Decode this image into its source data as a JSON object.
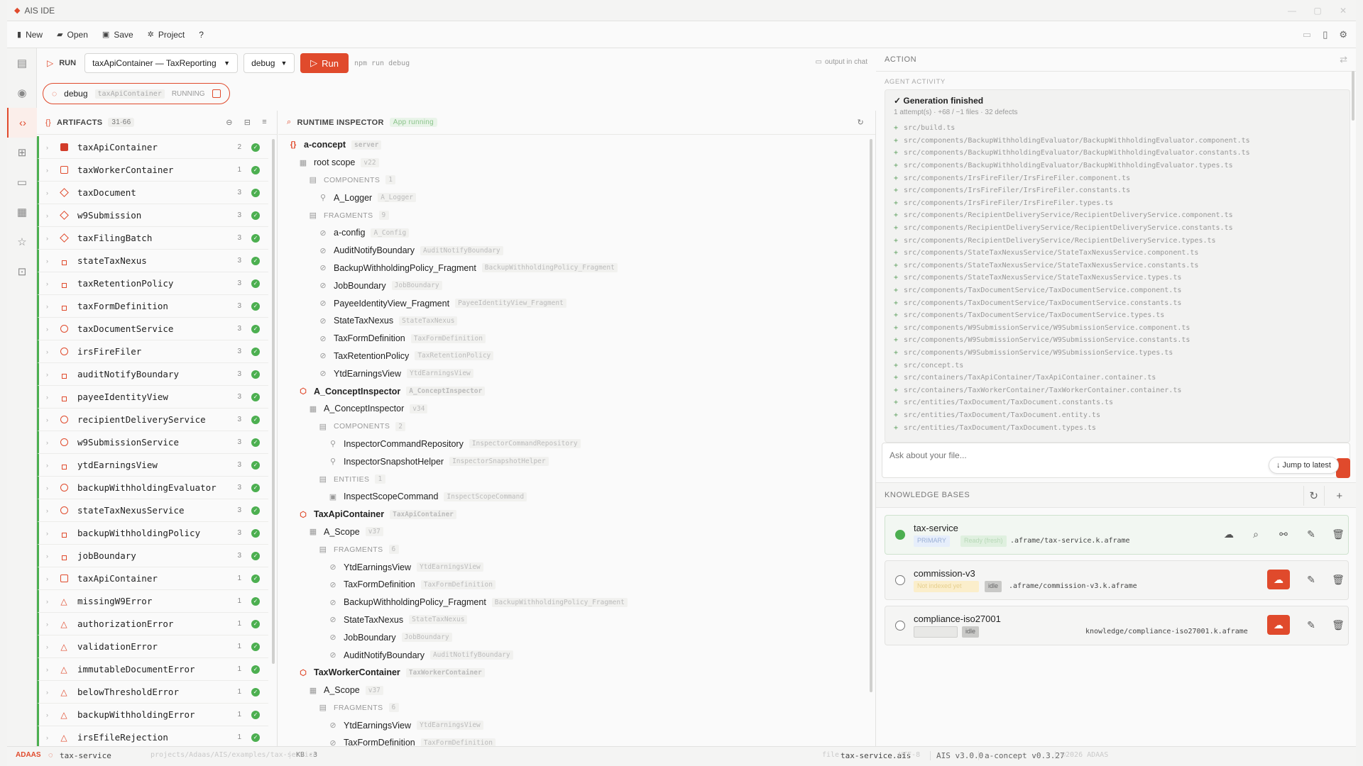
{
  "app": {
    "title": "AIS IDE"
  },
  "menu": {
    "new": "New",
    "open": "Open",
    "save": "Save",
    "project": "Project",
    "help": "?"
  },
  "run": {
    "label": "RUN",
    "target": "taxApiContainer — TaxReporting",
    "mode": "debug",
    "run_button": "Run",
    "command_hint": "npm run debug",
    "output_link": "output in chat"
  },
  "debug_session": {
    "name": "debug",
    "container": "taxApiContainer",
    "status": "RUNNING"
  },
  "artifacts": {
    "title": "ARTIFACTS",
    "count": "31·66",
    "items": [
      {
        "name": "taxApiContainer",
        "count": "2",
        "icon": "sq"
      },
      {
        "name": "taxWorkerContainer",
        "count": "1",
        "icon": "sqo"
      },
      {
        "name": "taxDocument",
        "count": "3",
        "icon": "dia"
      },
      {
        "name": "w9Submission",
        "count": "3",
        "icon": "dia"
      },
      {
        "name": "taxFilingBatch",
        "count": "3",
        "icon": "dia"
      },
      {
        "name": "stateTaxNexus",
        "count": "3",
        "icon": "sm"
      },
      {
        "name": "taxRetentionPolicy",
        "count": "3",
        "icon": "sm"
      },
      {
        "name": "taxFormDefinition",
        "count": "3",
        "icon": "sm"
      },
      {
        "name": "taxDocumentService",
        "count": "3",
        "icon": "circ"
      },
      {
        "name": "irsFireFiler",
        "count": "3",
        "icon": "circ"
      },
      {
        "name": "auditNotifyBoundary",
        "count": "3",
        "icon": "sm"
      },
      {
        "name": "payeeIdentityView",
        "count": "3",
        "icon": "sm"
      },
      {
        "name": "recipientDeliveryService",
        "count": "3",
        "icon": "circ"
      },
      {
        "name": "w9SubmissionService",
        "count": "3",
        "icon": "circ"
      },
      {
        "name": "ytdEarningsView",
        "count": "3",
        "icon": "sm"
      },
      {
        "name": "backupWithholdingEvaluator",
        "count": "3",
        "icon": "circ"
      },
      {
        "name": "stateTaxNexusService",
        "count": "3",
        "icon": "circ"
      },
      {
        "name": "backupWithholdingPolicy",
        "count": "3",
        "icon": "sm"
      },
      {
        "name": "jobBoundary",
        "count": "3",
        "icon": "sm"
      },
      {
        "name": "taxApiContainer",
        "count": "1",
        "icon": "sqo"
      },
      {
        "name": "missingW9Error",
        "count": "1",
        "icon": "tri"
      },
      {
        "name": "authorizationError",
        "count": "1",
        "icon": "tri"
      },
      {
        "name": "validationError",
        "count": "1",
        "icon": "tri"
      },
      {
        "name": "immutableDocumentError",
        "count": "1",
        "icon": "tri"
      },
      {
        "name": "belowThresholdError",
        "count": "1",
        "icon": "tri"
      },
      {
        "name": "backupWithholdingError",
        "count": "1",
        "icon": "tri"
      },
      {
        "name": "irsEfileRejection",
        "count": "1",
        "icon": "tri"
      }
    ]
  },
  "inspector": {
    "title": "RUNTIME INSPECTOR",
    "status": "App running",
    "rows": [
      {
        "label": "a-concept",
        "badge": "server",
        "level": 0,
        "kind": "brace",
        "bold": true
      },
      {
        "label": "root scope",
        "badge": "v22",
        "level": 1,
        "kind": "scope"
      },
      {
        "label": "COMPONENTS",
        "badge": "1",
        "level": 2,
        "kind": "sec"
      },
      {
        "label": "A_Logger",
        "badge": "A_Logger",
        "level": 3,
        "kind": "comp"
      },
      {
        "label": "FRAGMENTS",
        "badge": "9",
        "level": 2,
        "kind": "sec"
      },
      {
        "label": "a-config",
        "badge": "A_Config",
        "level": 3,
        "kind": "frag"
      },
      {
        "label": "AuditNotifyBoundary",
        "badge": "AuditNotifyBoundary",
        "level": 3,
        "kind": "frag"
      },
      {
        "label": "BackupWithholdingPolicy_Fragment",
        "badge": "BackupWithholdingPolicy_Fragment",
        "level": 3,
        "kind": "frag"
      },
      {
        "label": "JobBoundary",
        "badge": "JobBoundary",
        "level": 3,
        "kind": "frag"
      },
      {
        "label": "PayeeIdentityView_Fragment",
        "badge": "PayeeIdentityView_Fragment",
        "level": 3,
        "kind": "frag"
      },
      {
        "label": "StateTaxNexus",
        "badge": "StateTaxNexus",
        "level": 3,
        "kind": "frag"
      },
      {
        "label": "TaxFormDefinition",
        "badge": "TaxFormDefinition",
        "level": 3,
        "kind": "frag"
      },
      {
        "label": "TaxRetentionPolicy",
        "badge": "TaxRetentionPolicy",
        "level": 3,
        "kind": "frag"
      },
      {
        "label": "YtdEarningsView",
        "badge": "YtdEarningsView",
        "level": 3,
        "kind": "frag"
      },
      {
        "label": "A_ConceptInspector",
        "badge": "A_ConceptInspector",
        "level": 1,
        "kind": "cube",
        "bold": true
      },
      {
        "label": "A_ConceptInspector",
        "badge": "v34",
        "level": 2,
        "kind": "scope"
      },
      {
        "label": "COMPONENTS",
        "badge": "2",
        "level": 3,
        "kind": "sec"
      },
      {
        "label": "InspectorCommandRepository",
        "badge": "InspectorCommandRepository",
        "level": 4,
        "kind": "comp"
      },
      {
        "label": "InspectorSnapshotHelper",
        "badge": "InspectorSnapshotHelper",
        "level": 4,
        "kind": "comp"
      },
      {
        "label": "ENTITIES",
        "badge": "1",
        "level": 3,
        "kind": "sec"
      },
      {
        "label": "InspectScopeCommand",
        "badge": "InspectScopeCommand",
        "level": 4,
        "kind": "ent"
      },
      {
        "label": "TaxApiContainer",
        "badge": "TaxApiContainer",
        "level": 1,
        "kind": "cube",
        "bold": true
      },
      {
        "label": "A_Scope",
        "badge": "v37",
        "level": 2,
        "kind": "scope"
      },
      {
        "label": "FRAGMENTS",
        "badge": "6",
        "level": 3,
        "kind": "sec"
      },
      {
        "label": "YtdEarningsView",
        "badge": "YtdEarningsView",
        "level": 4,
        "kind": "frag"
      },
      {
        "label": "TaxFormDefinition",
        "badge": "TaxFormDefinition",
        "level": 4,
        "kind": "frag"
      },
      {
        "label": "BackupWithholdingPolicy_Fragment",
        "badge": "BackupWithholdingPolicy_Fragment",
        "level": 4,
        "kind": "frag"
      },
      {
        "label": "StateTaxNexus",
        "badge": "StateTaxNexus",
        "level": 4,
        "kind": "frag"
      },
      {
        "label": "JobBoundary",
        "badge": "JobBoundary",
        "level": 4,
        "kind": "frag"
      },
      {
        "label": "AuditNotifyBoundary",
        "badge": "AuditNotifyBoundary",
        "level": 4,
        "kind": "frag"
      },
      {
        "label": "TaxWorkerContainer",
        "badge": "TaxWorkerContainer",
        "level": 1,
        "kind": "cube",
        "bold": true
      },
      {
        "label": "A_Scope",
        "badge": "v37",
        "level": 2,
        "kind": "scope"
      },
      {
        "label": "FRAGMENTS",
        "badge": "6",
        "level": 3,
        "kind": "sec"
      },
      {
        "label": "YtdEarningsView",
        "badge": "YtdEarningsView",
        "level": 4,
        "kind": "frag"
      },
      {
        "label": "TaxFormDefinition",
        "badge": "TaxFormDefinition",
        "level": 4,
        "kind": "frag"
      }
    ]
  },
  "action": {
    "title": "ACTION",
    "agent_label": "AGENT ACTIVITY",
    "generation": "✓ Generation finished",
    "summary": "1 attempt(s) · +68 / −1 files · 32 defects",
    "files": [
      "src/build.ts",
      "src/components/BackupWithholdingEvaluator/BackupWithholdingEvaluator.component.ts",
      "src/components/BackupWithholdingEvaluator/BackupWithholdingEvaluator.constants.ts",
      "src/components/BackupWithholdingEvaluator/BackupWithholdingEvaluator.types.ts",
      "src/components/IrsFireFiler/IrsFireFiler.component.ts",
      "src/components/IrsFireFiler/IrsFireFiler.constants.ts",
      "src/components/IrsFireFiler/IrsFireFiler.types.ts",
      "src/components/RecipientDeliveryService/RecipientDeliveryService.component.ts",
      "src/components/RecipientDeliveryService/RecipientDeliveryService.constants.ts",
      "src/components/RecipientDeliveryService/RecipientDeliveryService.types.ts",
      "src/components/StateTaxNexusService/StateTaxNexusService.component.ts",
      "src/components/StateTaxNexusService/StateTaxNexusService.constants.ts",
      "src/components/StateTaxNexusService/StateTaxNexusService.types.ts",
      "src/components/TaxDocumentService/TaxDocumentService.component.ts",
      "src/components/TaxDocumentService/TaxDocumentService.constants.ts",
      "src/components/TaxDocumentService/TaxDocumentService.types.ts",
      "src/components/W9SubmissionService/W9SubmissionService.component.ts",
      "src/components/W9SubmissionService/W9SubmissionService.constants.ts",
      "src/components/W9SubmissionService/W9SubmissionService.types.ts",
      "src/concept.ts",
      "src/containers/TaxApiContainer/TaxApiContainer.container.ts",
      "src/containers/TaxWorkerContainer/TaxWorkerContainer.container.ts",
      "src/entities/TaxDocument/TaxDocument.constants.ts",
      "src/entities/TaxDocument/TaxDocument.entity.ts",
      "src/entities/TaxDocument/TaxDocument.types.ts"
    ],
    "chat_placeholder": "Ask about your file...",
    "jump_label": "↓ Jump to latest"
  },
  "knowledge": {
    "title": "KNOWLEDGE BASES",
    "items": [
      {
        "name": "tax-service",
        "path": ".aframe/tax-service.k.aframe",
        "chip1": "PRIMARY",
        "chip2": "Ready (fresh)",
        "active": true
      },
      {
        "name": "commission-v3",
        "path": ".aframe/commission-v3.k.aframe",
        "chip1": "Not indexed yet",
        "chip2": "idle",
        "active": false
      },
      {
        "name": "compliance-iso27001",
        "path": "knowledge/compliance-iso27001.k.aframe",
        "chip1": "",
        "chip2": "idle",
        "active": false
      }
    ]
  },
  "status": {
    "brand": "ADAAS",
    "project": "tax-service",
    "path": "projects/Adaas/AIS/examples/tax-service",
    "kb": "KB ·3",
    "file_label": "file",
    "file": "tax-service.ais",
    "encoding": "UTF-8",
    "ais": "AIS v3.0.0",
    "concept": "a-concept v0.3.27",
    "copyright": "©2026 ADAAS"
  },
  "colors": {
    "accent": "#e04a2c",
    "ok": "#4caf50"
  }
}
